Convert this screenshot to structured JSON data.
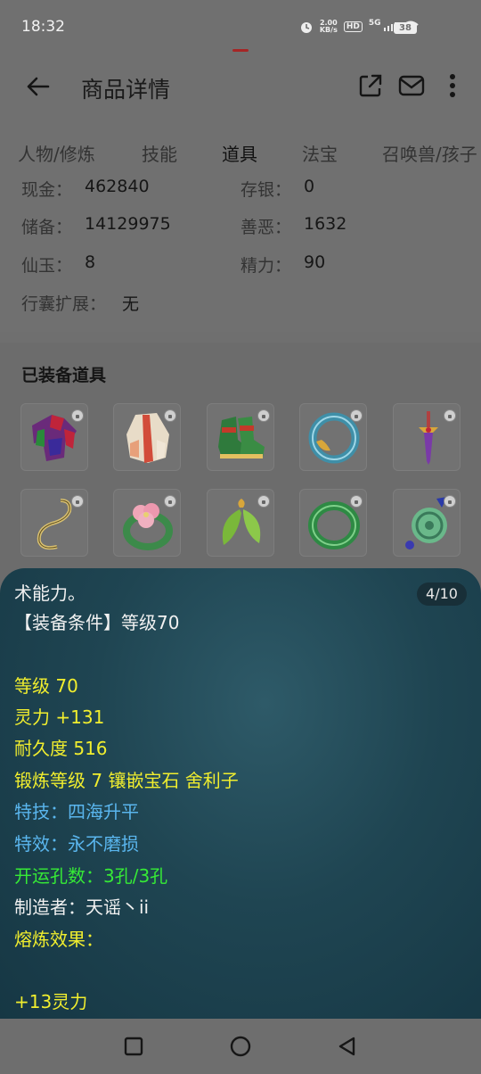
{
  "status_bar": {
    "time": "18:32",
    "net_speed_value": "2.00",
    "net_speed_unit": "KB/s",
    "hd_label": "HD",
    "network_type": "5G",
    "battery": "38"
  },
  "header": {
    "title": "商品详情"
  },
  "tabs": [
    {
      "label": "人物/修炼"
    },
    {
      "label": "技能"
    },
    {
      "label": "道具"
    },
    {
      "label": "法宝"
    },
    {
      "label": "召唤兽/孩子"
    }
  ],
  "active_tab": "道具",
  "info": {
    "cash_label": "现金：",
    "cash_value": "462840",
    "deposit_label": "存银：",
    "deposit_value": "0",
    "reserve_label": "储备：",
    "reserve_value": "14129975",
    "karma_label": "善恶：",
    "karma_value": "1632",
    "jade_label": "仙玉：",
    "jade_value": "8",
    "energy_label": "精力：",
    "energy_value": "90",
    "bag_label": "行囊扩展：",
    "bag_value": "无"
  },
  "equipped": {
    "title": "已装备道具",
    "items": [
      {
        "icon": "armor-icon"
      },
      {
        "icon": "robe-icon"
      },
      {
        "icon": "boots-icon"
      },
      {
        "icon": "dragon-ring-icon"
      },
      {
        "icon": "dagger-icon"
      },
      {
        "icon": "hook-icon"
      },
      {
        "icon": "flower-bracelet-icon"
      },
      {
        "icon": "leaf-pendant-icon"
      },
      {
        "icon": "jade-bracelet-icon"
      },
      {
        "icon": "jade-amulet-icon"
      }
    ]
  },
  "tooltip": {
    "counter": "4/10",
    "lines": [
      {
        "text": "术能力。",
        "color": "#f1f1f1"
      },
      {
        "text": "【装备条件】等级70",
        "color": "#f1f1f1"
      },
      {
        "text": "等级 70",
        "color": "#f1ee2e"
      },
      {
        "text": "灵力 +131",
        "color": "#f1ee2e"
      },
      {
        "text": "耐久度 516",
        "color": "#f1ee2e"
      },
      {
        "text": "锻炼等级 7 镶嵌宝石 舍利子",
        "color": "#f1ee2e"
      },
      {
        "text": "特技：四海升平",
        "color": "#5ab6ee"
      },
      {
        "text": "特效：永不磨损",
        "color": "#5ab6ee"
      },
      {
        "text": "开运孔数：3孔/3孔",
        "color": "#36ea36"
      },
      {
        "text": "制造者：天谣丶ii",
        "color": "#f1f1f1"
      },
      {
        "text": "熔炼效果：",
        "color": "#f1ee2e"
      },
      {
        "text": "+13灵力",
        "color": "#f1ee2e"
      }
    ]
  },
  "nav": {
    "recents": "square-icon",
    "home": "circle-icon",
    "back": "triangle-back-icon"
  }
}
